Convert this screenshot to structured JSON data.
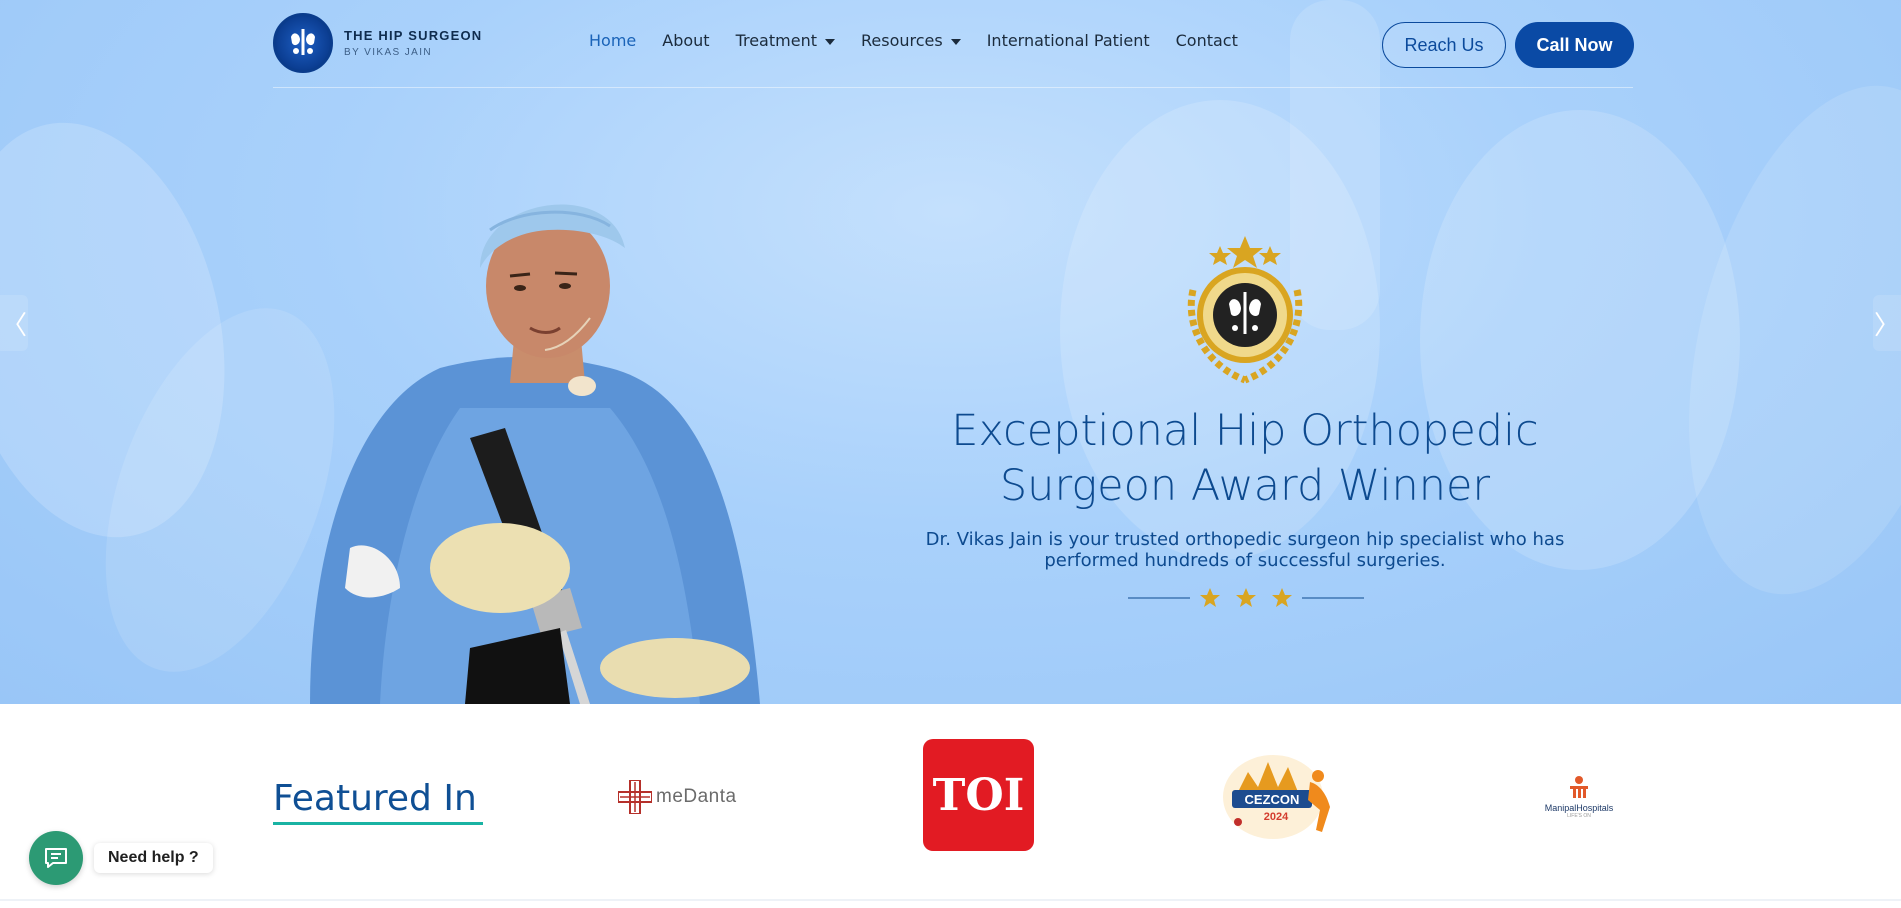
{
  "header": {
    "logo_title": "THE HIP SURGEON",
    "logo_subtitle": "BY VIKAS JAIN",
    "nav": [
      {
        "label": "Home",
        "active": true,
        "dropdown": false
      },
      {
        "label": "About",
        "active": false,
        "dropdown": false
      },
      {
        "label": "Treatment",
        "active": false,
        "dropdown": true
      },
      {
        "label": "Resources",
        "active": false,
        "dropdown": true
      },
      {
        "label": "International Patient",
        "active": false,
        "dropdown": false
      },
      {
        "label": "Contact",
        "active": false,
        "dropdown": false
      }
    ],
    "reach_button": "Reach Us",
    "call_button": "Call Now"
  },
  "hero": {
    "headline_line1": "Exceptional Hip Orthopedic",
    "headline_line2": "Surgeon Award Winner",
    "subtext_line1": "Dr. Vikas Jain is your trusted orthopedic surgeon hip specialist who has",
    "subtext_line2": "performed hundreds of successful surgeries.",
    "prev_arrow": "〈",
    "next_arrow": "〉",
    "star_count": 3
  },
  "featured": {
    "title": "Featured In",
    "logos": [
      "medanta",
      "TOI",
      "CEZCON 2024",
      "ManipalHospitals"
    ],
    "medanta_text": "meDanta",
    "toi_text": "TOI",
    "cezcon_text": "CEZCON",
    "cezcon_year": "2024",
    "manipal_text": "ManipalHospitals",
    "manipal_tagline": "LIFE'S ON"
  },
  "chat": {
    "label": "Need help ?"
  },
  "colors": {
    "brand_blue": "#0a4aa5",
    "nav_active": "#1a63b8",
    "headline": "#0d4a8f",
    "accent_teal": "#19b3a3",
    "gold": "#d9a521",
    "toi_red": "#e21b23",
    "chat_green": "#2c9a74"
  }
}
